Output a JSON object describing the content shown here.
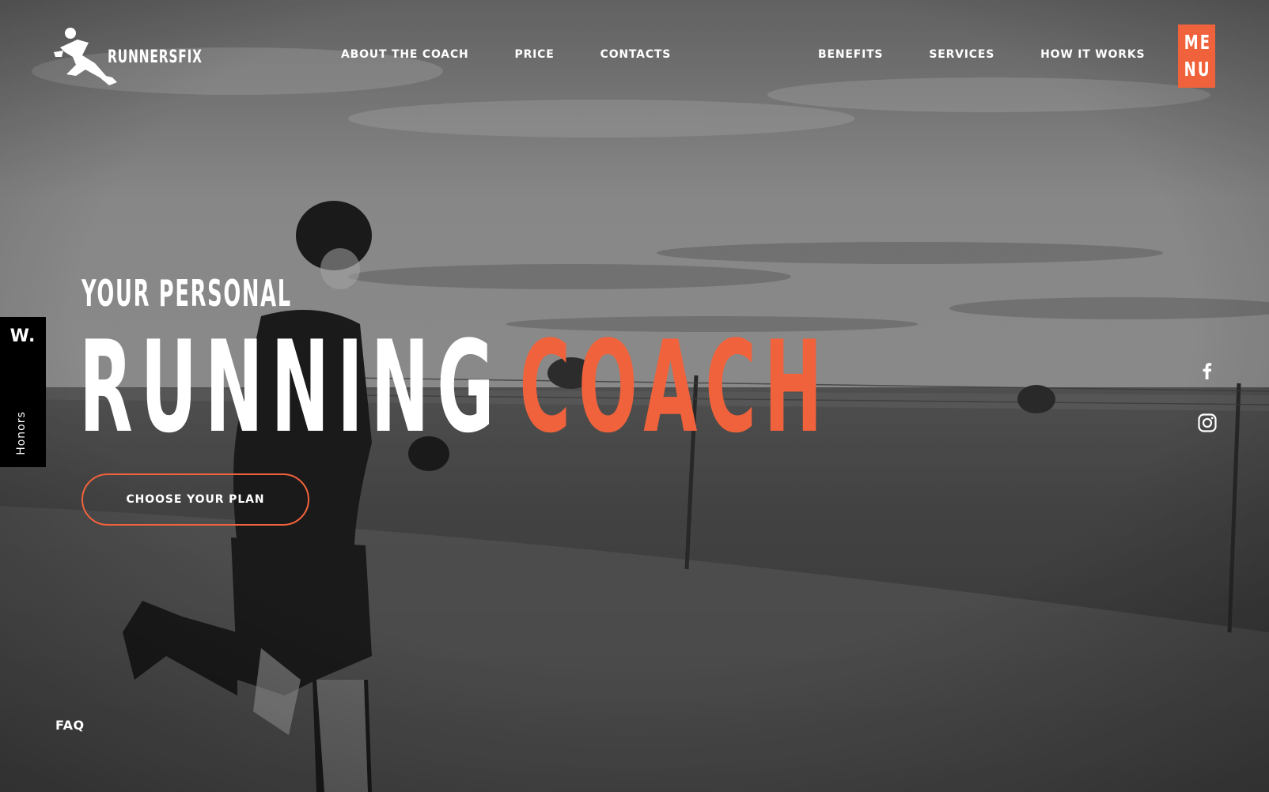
{
  "brand": {
    "name": "RUNNERSFIX"
  },
  "nav": {
    "left": [
      "ABOUT THE COACH",
      "PRICE",
      "CONTACTS"
    ],
    "right": [
      "BENEFITS",
      "SERVICES",
      "HOW IT WORKS"
    ]
  },
  "menu": {
    "line1": "ME",
    "line2": "NU"
  },
  "hero": {
    "kicker": "YOUR PERSONAL",
    "title_main": "RUNNING",
    "title_accent": "COACH",
    "cta_label": "CHOOSE YOUR PLAN"
  },
  "honors": {
    "badge": "W.",
    "label": "Honors"
  },
  "social": {
    "icons": [
      "facebook-icon",
      "instagram-icon"
    ]
  },
  "footer": {
    "faq_label": "FAQ"
  },
  "colors": {
    "accent": "#f0623c",
    "text": "#ffffff",
    "badge_bg": "#000000"
  }
}
